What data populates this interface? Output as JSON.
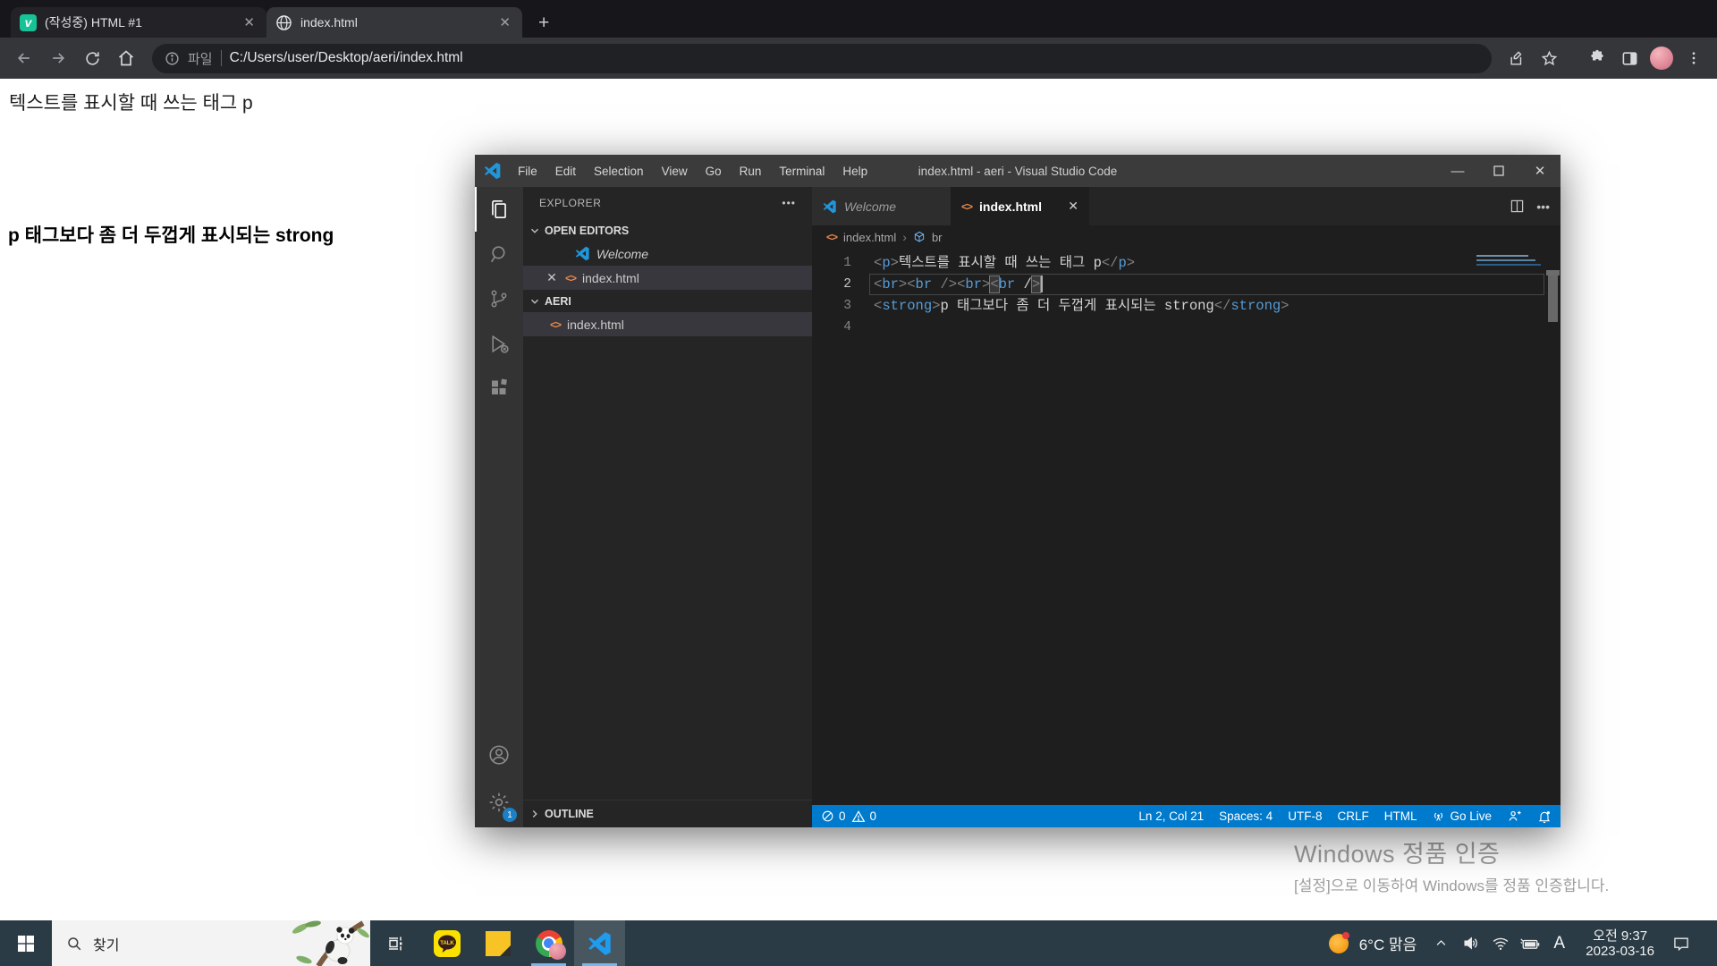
{
  "browser": {
    "tabs": [
      {
        "title": "(작성중) HTML #1",
        "favicon": "velog"
      },
      {
        "title": "index.html",
        "favicon": "globe"
      }
    ],
    "new_tab_label": "+",
    "address": {
      "scheme_label": "파일",
      "url": "C:/Users/user/Desktop/aeri/index.html"
    },
    "page": {
      "paragraph": "텍스트를 표시할 때 쓰는 태그 p",
      "strong": "p 태그보다 좀 더 두껍게 표시되는 strong"
    }
  },
  "vscode": {
    "window_title": "index.html - aeri - Visual Studio Code",
    "menus": [
      "File",
      "Edit",
      "Selection",
      "View",
      "Go",
      "Run",
      "Terminal",
      "Help"
    ],
    "activity_badge": "1",
    "explorer": {
      "header": "EXPLORER",
      "open_editors_label": "OPEN EDITORS",
      "open_editors": [
        {
          "name": "Welcome"
        },
        {
          "name": "index.html"
        }
      ],
      "folder": "AERI",
      "folder_files": [
        {
          "name": "index.html"
        }
      ],
      "outline_label": "OUTLINE"
    },
    "editor_tabs": [
      {
        "label": "Welcome"
      },
      {
        "label": "index.html"
      }
    ],
    "breadcrumb": [
      "index.html",
      "br"
    ],
    "code": [
      {
        "num": "1",
        "tokens": [
          [
            "pu",
            "<"
          ],
          [
            "tag",
            "p"
          ],
          [
            "pu",
            ">"
          ],
          [
            "tx",
            "텍스트를 표시할 때 쓰는 태그 p"
          ],
          [
            "pu",
            "</"
          ],
          [
            "tag",
            "p"
          ],
          [
            "pu",
            ">"
          ]
        ]
      },
      {
        "num": "2",
        "active": true,
        "tokens": [
          [
            "pu",
            "<"
          ],
          [
            "tag",
            "br"
          ],
          [
            "pu",
            ">"
          ],
          [
            "pu",
            "<"
          ],
          [
            "tag",
            "br"
          ],
          [
            "tx",
            " "
          ],
          [
            "pu",
            "/>"
          ],
          [
            "pu",
            "<"
          ],
          [
            "tag",
            "br"
          ],
          [
            "pu",
            ">"
          ],
          [
            "pu-match",
            "<"
          ],
          [
            "tag",
            "br"
          ],
          [
            "tx",
            " /"
          ],
          [
            "pu-match",
            ">"
          ],
          [
            "cursor",
            ""
          ]
        ]
      },
      {
        "num": "3",
        "tokens": [
          [
            "pu",
            "<"
          ],
          [
            "tag",
            "strong"
          ],
          [
            "pu",
            ">"
          ],
          [
            "tx",
            "p 태그보다 좀 더 두껍게 표시되는 strong"
          ],
          [
            "pu",
            "</"
          ],
          [
            "tag",
            "strong"
          ],
          [
            "pu",
            ">"
          ]
        ]
      },
      {
        "num": "4",
        "tokens": []
      }
    ],
    "status": {
      "errors": "0",
      "warnings": "0",
      "items": [
        "Ln 2, Col 21",
        "Spaces: 4",
        "UTF-8",
        "CRLF",
        "HTML",
        "Go Live"
      ]
    }
  },
  "watermark": {
    "line1": "Windows 정품 인증",
    "line2": "[설정]으로 이동하여 Windows를 정품 인증합니다."
  },
  "taskbar": {
    "search_placeholder": "찾기",
    "kakao_label": "TALK",
    "weather_temp": "6°C",
    "weather_desc": "맑음",
    "ime": "A",
    "time": "오전 9:37",
    "date": "2023-03-16"
  },
  "colors": {
    "vscode_statusbar": "#007acc",
    "code_tag": "#569cd6",
    "code_punct": "#808080",
    "code_text": "#d4d4d4",
    "velog_green": "#17c297",
    "kakao_yellow": "#fae100",
    "taskbar": "#2a3b45"
  }
}
